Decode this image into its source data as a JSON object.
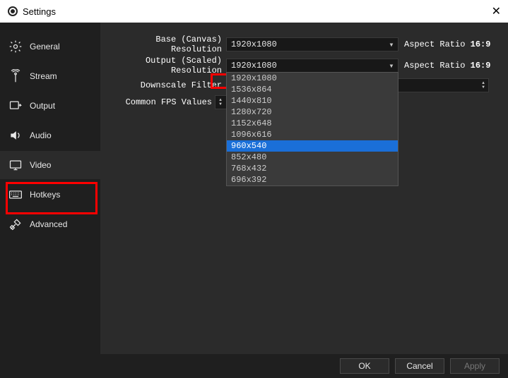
{
  "titlebar": {
    "title": "Settings"
  },
  "sidebar": {
    "items": [
      {
        "label": "General"
      },
      {
        "label": "Stream"
      },
      {
        "label": "Output"
      },
      {
        "label": "Audio"
      },
      {
        "label": "Video"
      },
      {
        "label": "Hotkeys"
      },
      {
        "label": "Advanced"
      }
    ]
  },
  "video": {
    "base_label": "Base (Canvas) Resolution",
    "base_value": "1920x1080",
    "base_aspect_label": "Aspect Ratio",
    "base_aspect_value": "16:9",
    "output_label": "Output (Scaled) Resolution",
    "output_value": "1920x1080",
    "output_aspect_label": "Aspect Ratio",
    "output_aspect_value": "16:9",
    "downscale_label": "Downscale Filter",
    "fps_label": "Common FPS Values",
    "output_options": [
      "1920x1080",
      "1536x864",
      "1440x810",
      "1280x720",
      "1152x648",
      "1096x616",
      "960x540",
      "852x480",
      "768x432",
      "696x392"
    ],
    "output_selected": "960x540"
  },
  "footer": {
    "ok": "OK",
    "cancel": "Cancel",
    "apply": "Apply"
  }
}
